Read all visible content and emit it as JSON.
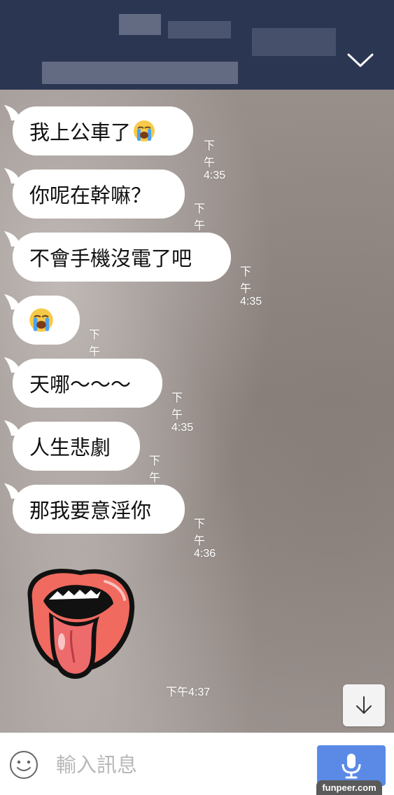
{
  "header": {
    "collapse_icon": "chevron-down-icon"
  },
  "messages": [
    {
      "text": "我上公車了",
      "emoji": "loudly-crying-face",
      "time": "下午4:35"
    },
    {
      "text": "你呢在幹嘛？",
      "time": "下午4:35"
    },
    {
      "text": "不會手機沒電了吧",
      "time": "下午4:35"
    },
    {
      "text": "",
      "emoji": "loudly-crying-face",
      "time": "下午4:35"
    },
    {
      "text": "天哪～～～",
      "time": "下午4:35"
    },
    {
      "text": "人生悲劇",
      "time": "下午4:35"
    },
    {
      "text": "那我要意淫你",
      "time": "下午4:36"
    }
  ],
  "sticker": {
    "name": "mouth-tongue-sticker",
    "time": "下午4:37"
  },
  "input": {
    "placeholder": "輸入訊息",
    "value": ""
  },
  "buttons": {
    "scroll_icon": "arrow-down-icon",
    "emoji_icon": "smiley-icon",
    "voice_icon": "microphone-icon"
  },
  "watermark": "funpeer.com",
  "colors": {
    "header": "#2b3652",
    "bubble": "#ffffff",
    "voice_button": "#5b8ae6"
  }
}
